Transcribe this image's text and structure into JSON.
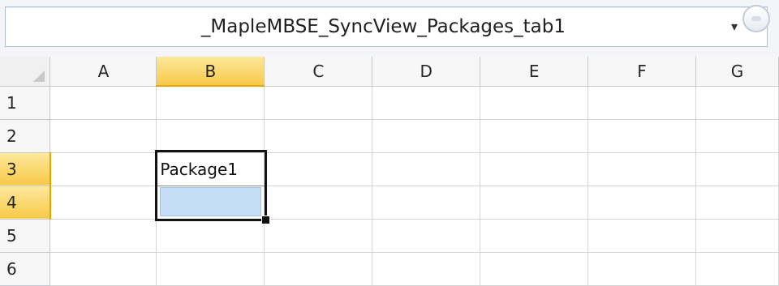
{
  "name_box": {
    "value": "_MapleMBSE_SyncView_Packages_tab1"
  },
  "columns": [
    "A",
    "B",
    "C",
    "D",
    "E",
    "F",
    "G"
  ],
  "selected_column": "B",
  "rows": [
    {
      "num": "1",
      "cells": [
        "",
        "",
        "",
        "",
        "",
        "",
        ""
      ]
    },
    {
      "num": "2",
      "cells": [
        "",
        "",
        "",
        "",
        "",
        "",
        ""
      ]
    },
    {
      "num": "3",
      "cells": [
        "",
        "Package1",
        "",
        "",
        "",
        "",
        ""
      ]
    },
    {
      "num": "4",
      "cells": [
        "",
        "",
        "",
        "",
        "",
        "",
        ""
      ]
    },
    {
      "num": "5",
      "cells": [
        "",
        "",
        "",
        "",
        "",
        "",
        ""
      ]
    },
    {
      "num": "6",
      "cells": [
        "",
        "",
        "",
        "",
        "",
        "",
        ""
      ]
    }
  ],
  "selected_rows": [
    "3",
    "4"
  ],
  "active_cell": "B4",
  "icons": {
    "name_box_dropdown": "chevron-down-icon",
    "function_button": "circle-button-icon",
    "select_all": "select-all-triangle-icon"
  },
  "colors": {
    "selected_header": "#f8c948",
    "active_cell_fill": "#c5ddf7",
    "grid_line": "#d4d4d4"
  }
}
